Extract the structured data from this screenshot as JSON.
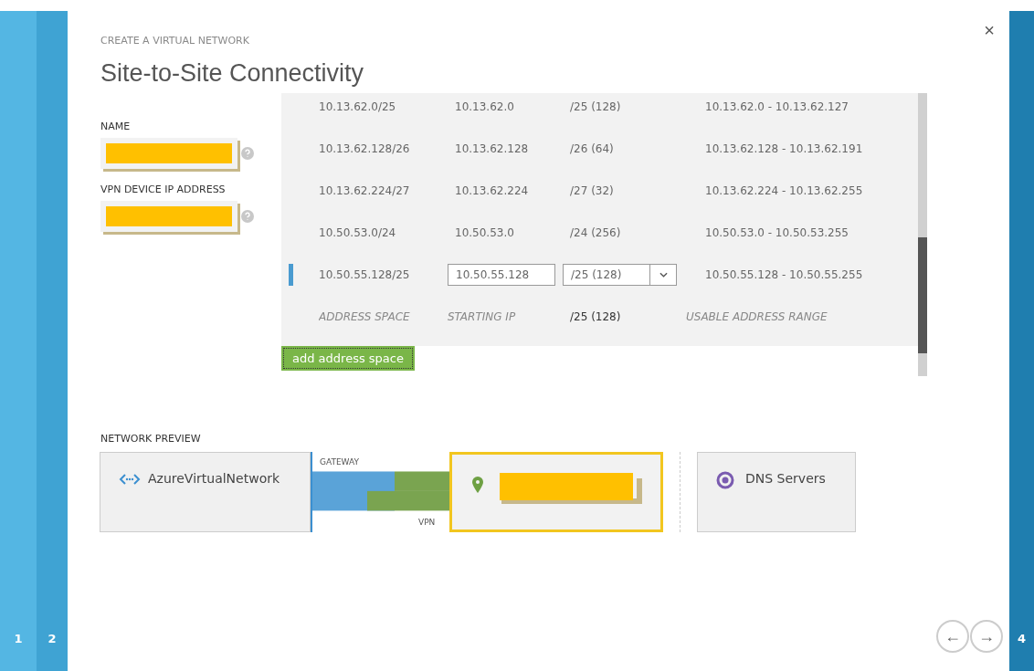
{
  "wizard": {
    "steps": [
      {
        "label": "1",
        "completed": true
      },
      {
        "label": "2",
        "completed": true
      },
      {
        "label": "4",
        "completed": false
      }
    ],
    "close": "×"
  },
  "header": {
    "subtitle": "CREATE A VIRTUAL NETWORK",
    "title": "Site-to-Site Connectivity"
  },
  "form": {
    "fields": [
      {
        "label": "NAME",
        "redacted": true
      },
      {
        "label": "VPN DEVICE IP ADDRESS",
        "redacted": true
      }
    ]
  },
  "address_table": {
    "rows": [
      {
        "address_space": "10.13.62.0/25",
        "starting_ip": "10.13.62.0",
        "cidr": "/25 (128)",
        "range": "10.13.62.0 - 10.13.62.127",
        "editing": false
      },
      {
        "address_space": "10.13.62.128/26",
        "starting_ip": "10.13.62.128",
        "cidr": "/26 (64)",
        "range": "10.13.62.128 - 10.13.62.191",
        "editing": false
      },
      {
        "address_space": "10.13.62.224/27",
        "starting_ip": "10.13.62.224",
        "cidr": "/27 (32)",
        "range": "10.13.62.224 - 10.13.62.255",
        "editing": false
      },
      {
        "address_space": "10.50.53.0/24",
        "starting_ip": "10.50.53.0",
        "cidr": "/24 (256)",
        "range": "10.50.53.0 - 10.50.53.255",
        "editing": false
      },
      {
        "address_space": "10.50.55.128/25",
        "starting_ip": "10.50.55.128",
        "cidr": "/25 (128)",
        "range": "10.50.55.128 - 10.50.55.255",
        "editing": true
      }
    ],
    "new_row": {
      "address_space_placeholder": "ADDRESS SPACE",
      "starting_ip_placeholder": "STARTING IP",
      "cidr": "/25 (128)",
      "range_placeholder": "USABLE ADDRESS RANGE"
    },
    "add_button": "add address space"
  },
  "network_preview": {
    "label": "NETWORK PREVIEW",
    "virtual_network": "AzureVirtualNetwork",
    "gateway_label": "GATEWAY",
    "vpn_label": "VPN",
    "local_site": {
      "redacted": true,
      "selected": true
    },
    "dns": "DNS Servers"
  },
  "navigation": {
    "back": "←",
    "next": "→"
  }
}
